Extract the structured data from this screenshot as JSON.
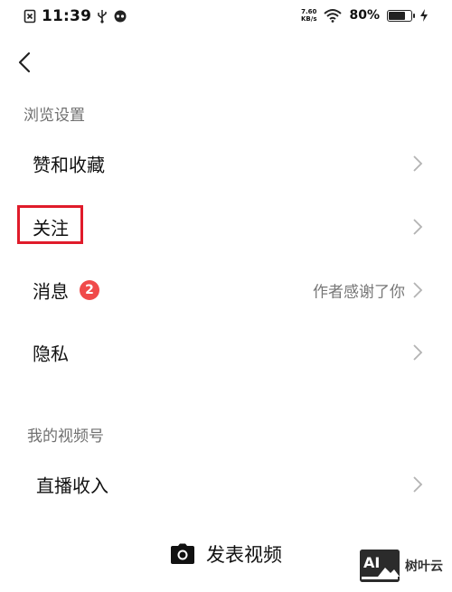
{
  "status_bar": {
    "time": "11:39",
    "net_speed_value": "7.60",
    "net_speed_unit": "KB/s",
    "battery_percent": "80%",
    "battery_level": 0.8,
    "icons": [
      "sim-icon",
      "usb-icon",
      "app-notification-icon",
      "wifi-icon",
      "battery-icon",
      "charging-icon"
    ]
  },
  "nav": {
    "back_icon": "chevron-left-icon"
  },
  "sections": [
    {
      "title": "浏览设置",
      "items": [
        {
          "label": "赞和收藏",
          "value": "",
          "badge": ""
        },
        {
          "label": "关注",
          "value": "",
          "badge": ""
        },
        {
          "label": "消息",
          "value": "作者感谢了你",
          "badge": "2"
        },
        {
          "label": "隐私",
          "value": "",
          "badge": ""
        }
      ]
    },
    {
      "title": "我的视频号",
      "items": [
        {
          "label": "直播收入",
          "value": "",
          "badge": ""
        }
      ]
    }
  ],
  "bottom_action": {
    "label": "发表视频",
    "icon": "camera-icon"
  },
  "watermark": {
    "text": "树叶云",
    "logo_text": "AI"
  },
  "colors": {
    "highlight_border": "#e01b2a",
    "badge_bg": "#f04a4a",
    "secondary_text": "#777777"
  }
}
